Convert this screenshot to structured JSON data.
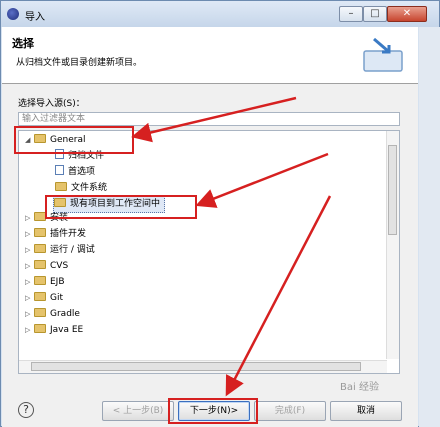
{
  "window": {
    "title": "导入"
  },
  "header": {
    "title": "选择",
    "description": "从归档文件或目录创建新项目。"
  },
  "source": {
    "label": "选择导入源(S)：",
    "filter_placeholder": "输入过滤器文本"
  },
  "tree": {
    "items": [
      {
        "label": "General",
        "expander": "◢",
        "icon": "folder-open-icon"
      },
      {
        "label": "归档文件",
        "icon": "archive-icon"
      },
      {
        "label": "首选项",
        "icon": "preferences-icon"
      },
      {
        "label": "文件系统",
        "icon": "folder-icon"
      },
      {
        "label": "现有项目到工作空间中",
        "icon": "project-import-icon",
        "selected": true
      },
      {
        "label": "安装",
        "expander": "▷",
        "icon": "folder-icon"
      },
      {
        "label": "插件开发",
        "expander": "▷",
        "icon": "folder-icon"
      },
      {
        "label": "运行 / 调试",
        "expander": "▷",
        "icon": "folder-icon"
      },
      {
        "label": "CVS",
        "expander": "▷",
        "icon": "folder-icon"
      },
      {
        "label": "EJB",
        "expander": "▷",
        "icon": "folder-icon"
      },
      {
        "label": "Git",
        "expander": "▷",
        "icon": "folder-icon"
      },
      {
        "label": "Gradle",
        "expander": "▷",
        "icon": "folder-icon"
      },
      {
        "label": "Java EE",
        "expander": "▷",
        "icon": "folder-icon"
      }
    ]
  },
  "buttons": {
    "help": "?",
    "back": "< 上一步(B)",
    "next": "下一步(N)>",
    "finish": "完成(F)",
    "cancel": "取消"
  },
  "titlebar": {
    "minimize": "–",
    "maximize": "□",
    "close": "✕"
  },
  "watermark": "Bai 经验",
  "colors": {
    "highlight": "#d62020",
    "header_bg": "#ffffff",
    "selected_bg": "#dfe8f6"
  }
}
